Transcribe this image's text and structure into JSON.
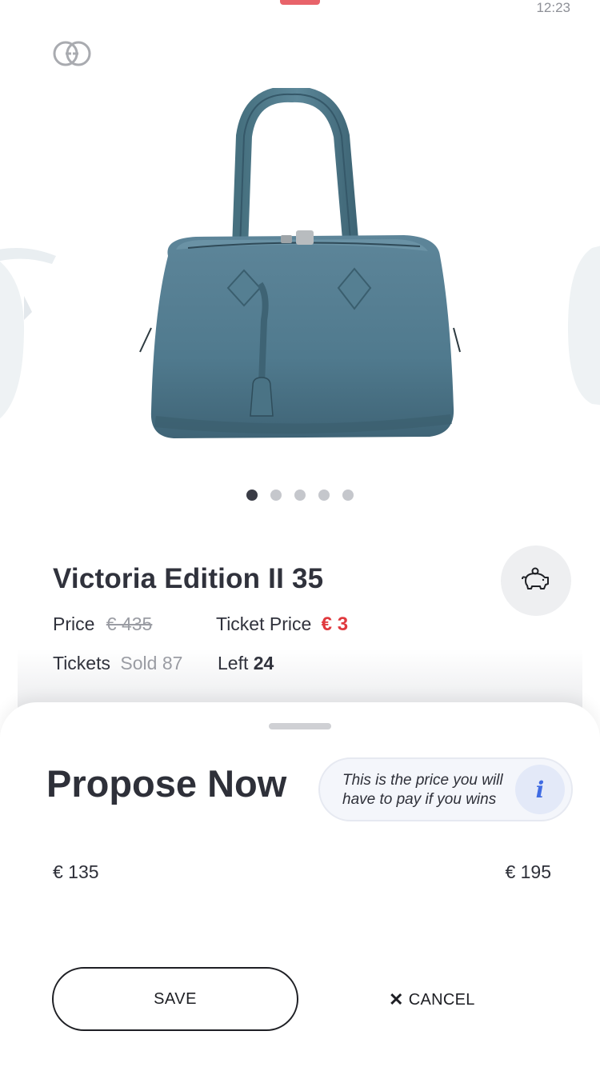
{
  "status_bar": {
    "time": "12:23"
  },
  "brand": {
    "logo_icon": "gucci-logo-icon"
  },
  "carousel": {
    "slide_count": 5,
    "active_index": 0
  },
  "product": {
    "title": "Victoria Edition II 35",
    "price_label": "Price",
    "price_value": "€ 435",
    "ticket_price_label": "Ticket Price",
    "ticket_price_value": "€ 3",
    "tickets_label": "Tickets",
    "sold_value": "Sold 87",
    "left_label": "Left",
    "left_value": "24",
    "piggy_icon": "piggy-bank-icon"
  },
  "propose_sheet": {
    "title": "Propose Now",
    "info_text": "This is the price you will have to pay if you wins",
    "info_icon_glyph": "i",
    "range_min": "€ 135",
    "range_max": "€ 195",
    "save_label": "SAVE",
    "cancel_label": "CANCEL"
  },
  "colors": {
    "accent_red": "#e0393e",
    "info_blue": "#3f6be3",
    "bag_blue": "#507a8e"
  }
}
